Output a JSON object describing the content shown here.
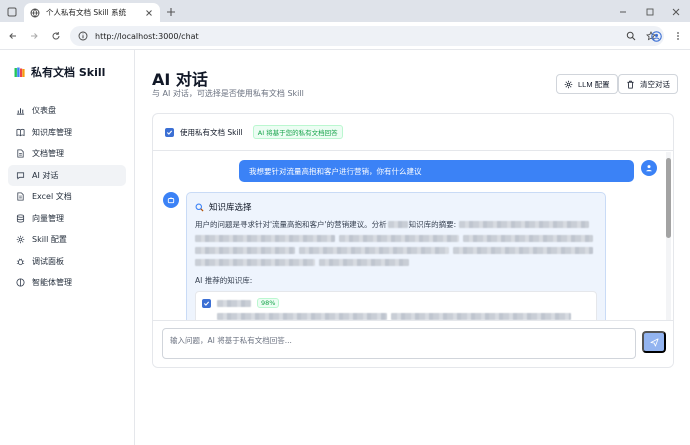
{
  "browser": {
    "tab_title": "个人私有文档 Skill 系统",
    "url": "http://localhost:3000/chat"
  },
  "sidebar": {
    "brand": "私有文档 Skill",
    "items": [
      {
        "label": "仪表盘",
        "icon": "chart-icon"
      },
      {
        "label": "知识库管理",
        "icon": "book-icon"
      },
      {
        "label": "文档管理",
        "icon": "document-icon"
      },
      {
        "label": "AI 对话",
        "icon": "chat-icon",
        "active": true
      },
      {
        "label": "Excel 文档",
        "icon": "spreadsheet-icon"
      },
      {
        "label": "向量管理",
        "icon": "database-icon"
      },
      {
        "label": "Skill 配置",
        "icon": "gear-icon"
      },
      {
        "label": "调试面板",
        "icon": "bug-icon"
      },
      {
        "label": "智能体管理",
        "icon": "agent-icon"
      }
    ]
  },
  "header": {
    "title": "AI 对话",
    "subtitle": "与 AI 对话，可选择是否使用私有文档 Skill",
    "llm_button": "LLM 配置",
    "clear_button": "清空对话"
  },
  "options": {
    "use_skill_label": "使用私有文档 Skill",
    "use_skill_checked": true,
    "badge": "AI 将基于您的私有文档回答"
  },
  "messages": {
    "user": "我想要针对流量高抱和客户进行营销，你有什么建议",
    "kb_title": "知识库选择",
    "kb_desc_start": "用户的问题是寻求针对'流量高抱和客户'的营销建议。分析",
    "kb_desc_mid": "知识库的摘要:",
    "recommended_label": "AI 推荐的知识库:",
    "recommended_score": "98%"
  },
  "composer": {
    "placeholder": "输入问题，AI 将基于私有文档回答..."
  },
  "colors": {
    "accent": "#3b82f6",
    "badge_green": "#16a34a"
  }
}
